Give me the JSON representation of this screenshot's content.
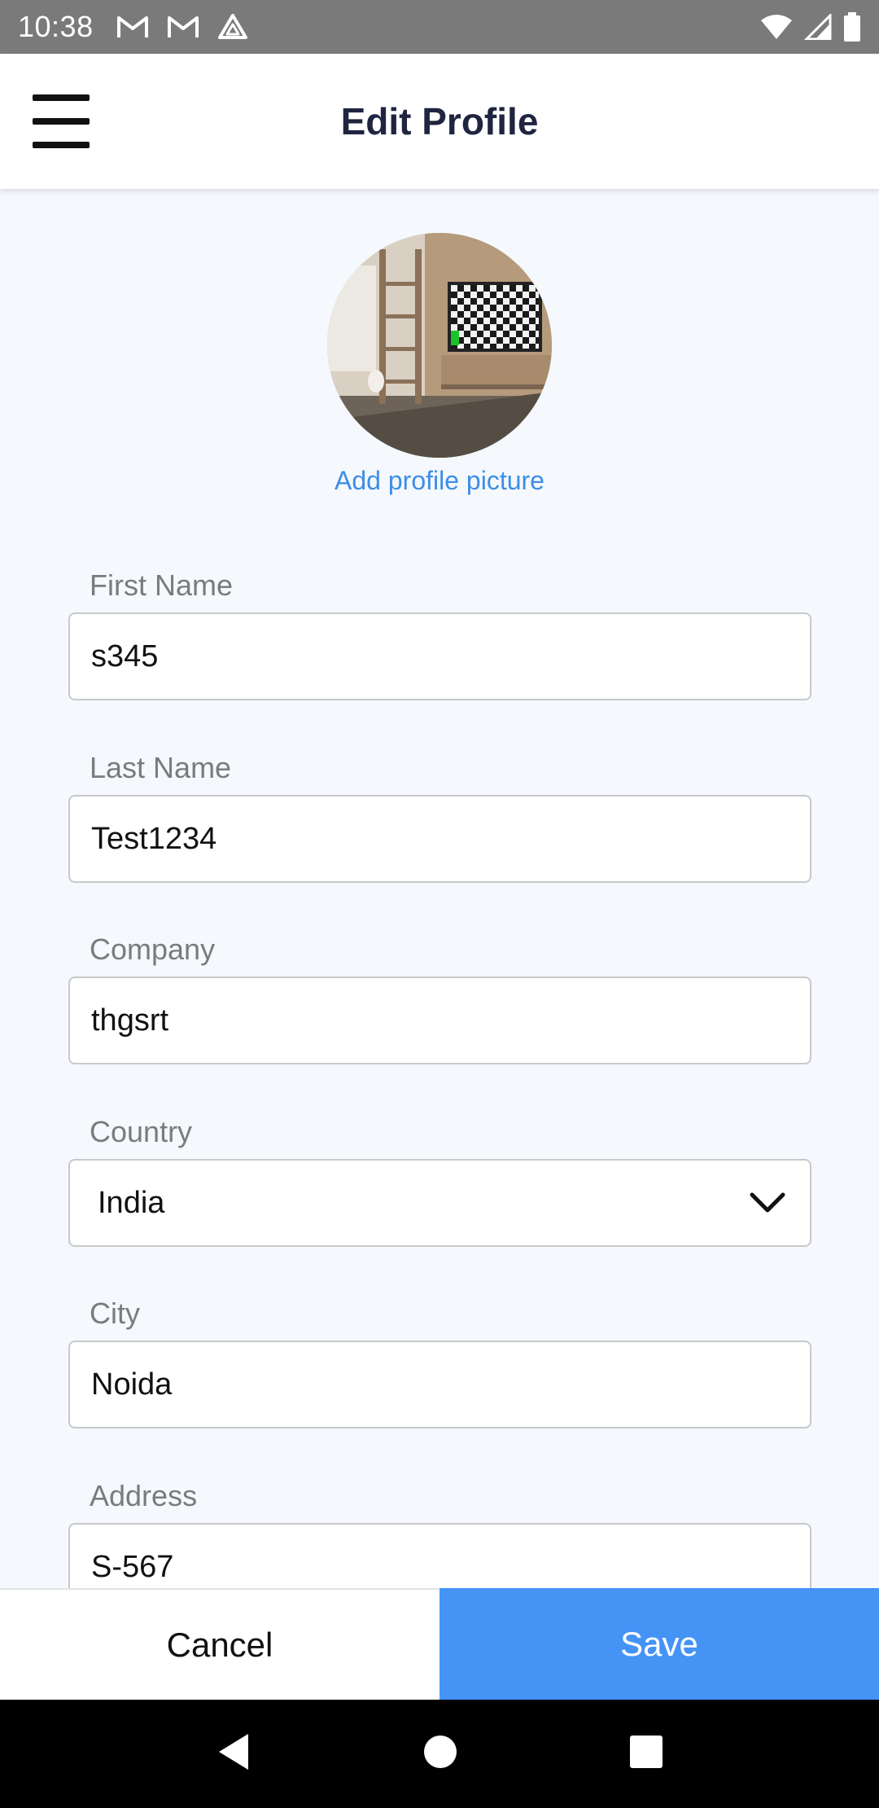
{
  "status_bar": {
    "time": "10:38",
    "notification_icons": [
      "gmail-icon",
      "gmail-icon",
      "drive-icon"
    ],
    "right_icons": [
      "wifi-icon",
      "signal-icon",
      "battery-icon"
    ]
  },
  "app_bar": {
    "title": "Edit Profile",
    "menu_icon": "hamburger-menu-icon"
  },
  "profile": {
    "add_picture_label": "Add profile picture"
  },
  "form": {
    "first_name": {
      "label": "First Name",
      "value": "s345"
    },
    "last_name": {
      "label": "Last Name",
      "value": "Test1234"
    },
    "company": {
      "label": "Company",
      "value": "thgsrt"
    },
    "country": {
      "label": "Country",
      "value": "India"
    },
    "city": {
      "label": "City",
      "value": "Noida"
    },
    "address": {
      "label": "Address",
      "value": "S-567"
    }
  },
  "actions": {
    "cancel_label": "Cancel",
    "save_label": "Save"
  },
  "colors": {
    "accent": "#4593f5",
    "link": "#3d8ee6",
    "title": "#1f2540",
    "background": "#f5f8fc"
  },
  "nav_bar": {
    "icons": [
      "back-icon",
      "home-icon",
      "recents-icon"
    ]
  }
}
